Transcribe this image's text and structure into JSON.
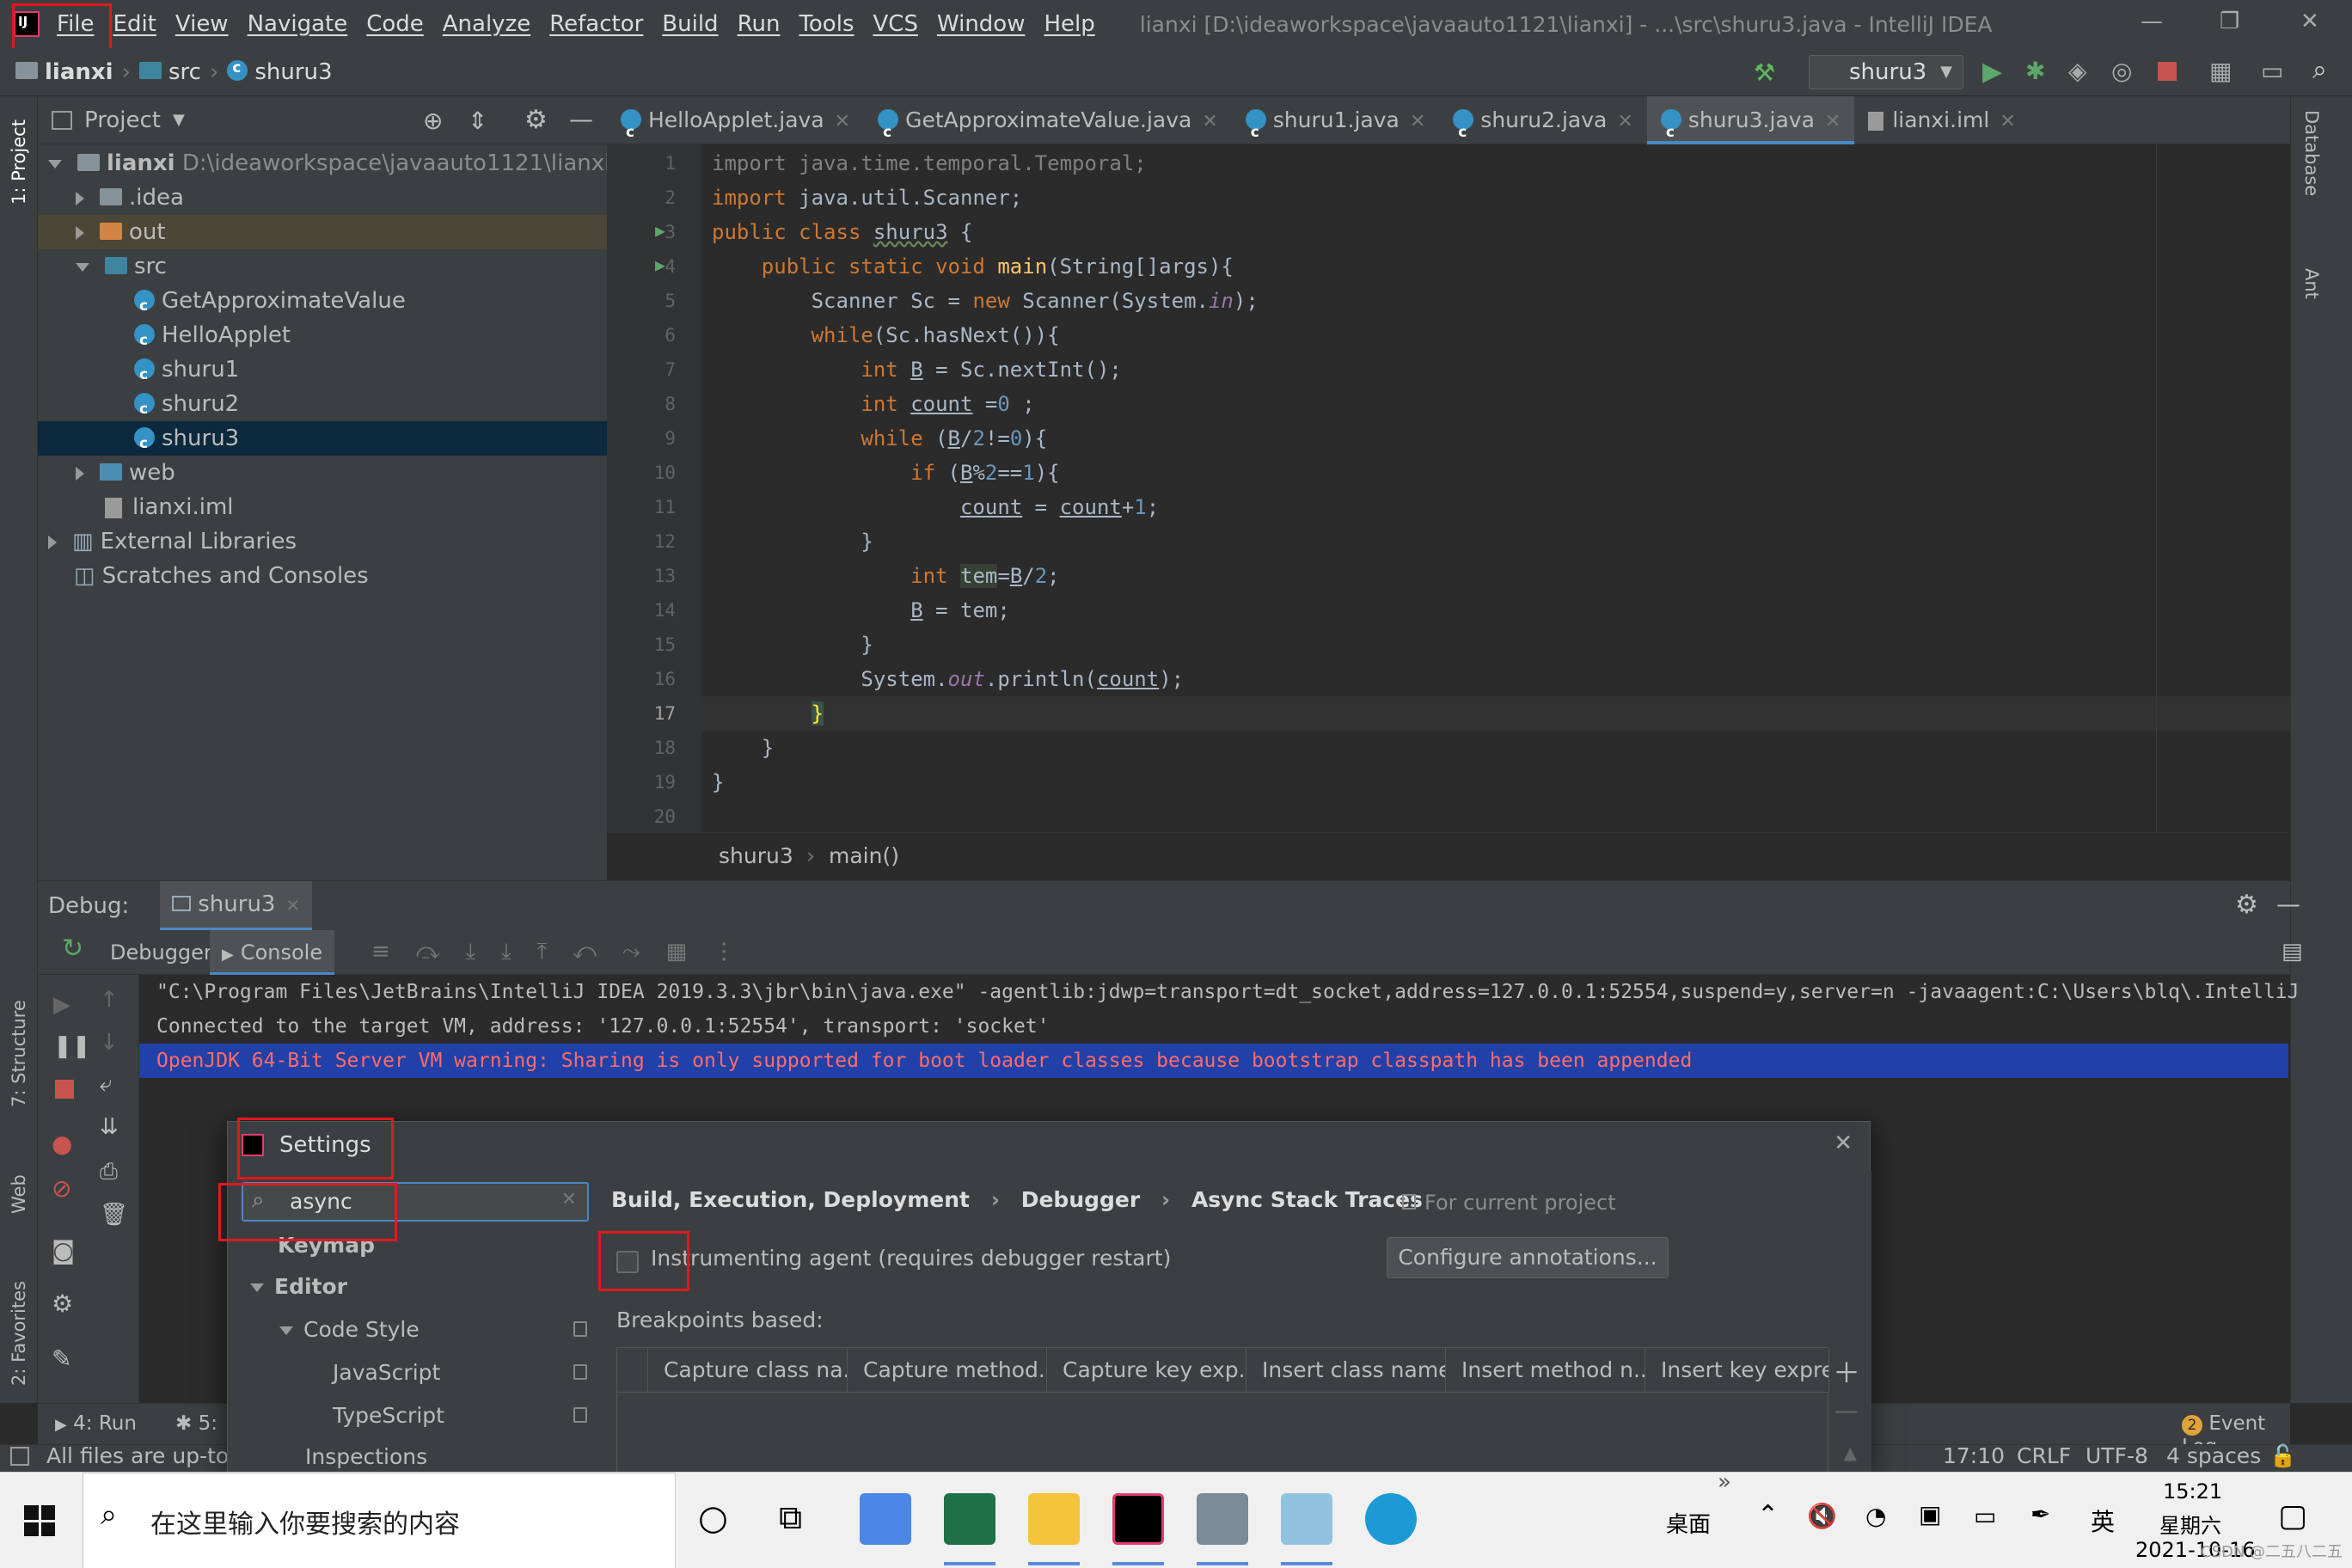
{
  "window": {
    "title": "lianxi [D:\\ideaworkspace\\javaauto1121\\lianxi] - ...\\src\\shuru3.java - IntelliJ IDEA",
    "menu": [
      "File",
      "Edit",
      "View",
      "Navigate",
      "Code",
      "Analyze",
      "Refactor",
      "Build",
      "Run",
      "Tools",
      "VCS",
      "Window",
      "Help"
    ]
  },
  "navbar": {
    "project": "lianxi",
    "folder": "src",
    "file": "shuru3",
    "run_config": "shuru3"
  },
  "project_panel": {
    "title": "Project",
    "root_name": "lianxi",
    "root_path": "D:\\ideaworkspace\\javaauto1121\\lianxi",
    "items": [
      ".idea",
      "out",
      "src",
      "GetApproximateValue",
      "HelloApplet",
      "shuru1",
      "shuru2",
      "shuru3",
      "web",
      "lianxi.iml",
      "External Libraries",
      "Scratches and Consoles"
    ]
  },
  "left_strip": {
    "project": "1: Project",
    "structure": "7: Structure",
    "web": "Web",
    "favorites": "2: Favorites"
  },
  "right_strip": {
    "database": "Database",
    "ant": "Ant"
  },
  "editor": {
    "tabs": [
      "HelloApplet.java",
      "GetApproximateValue.java",
      "shuru1.java",
      "shuru2.java",
      "shuru3.java",
      "lianxi.iml"
    ],
    "active_tab": 4,
    "line_numbers": [
      "1",
      "2",
      "3",
      "4",
      "5",
      "6",
      "7",
      "8",
      "9",
      "10",
      "11",
      "12",
      "13",
      "14",
      "15",
      "16",
      "17",
      "18",
      "19",
      "20"
    ],
    "breadcrumb": [
      "shuru3",
      "main()"
    ]
  },
  "debug": {
    "label": "Debug:",
    "session": "shuru3",
    "tabs": [
      "Debugger",
      "Console"
    ],
    "console_lines": [
      "\"C:\\Program Files\\JetBrains\\IntelliJ IDEA 2019.3.3\\jbr\\bin\\java.exe\" -agentlib:jdwp=transport=dt_socket,address=127.0.0.1:52554,suspend=y,server=n -javaagent:C:\\Users\\blq\\.IntelliJ",
      "Connected to the target VM, address: '127.0.0.1:52554', transport: 'socket'",
      "OpenJDK 64-Bit Server VM warning: Sharing is only supported for boot loader classes because bootstrap classpath has been appended"
    ]
  },
  "bottom_bar": {
    "run": "4: Run",
    "debug": "5:",
    "event_log": "Event Log",
    "event_count": "2"
  },
  "status": {
    "message": "All files are up-to-d",
    "position": "17:10",
    "line_sep": "CRLF",
    "encoding": "UTF-8",
    "indent": "4 spaces"
  },
  "settings": {
    "title": "Settings",
    "search_value": "async",
    "tree": [
      "Keymap",
      "Editor",
      "Code Style",
      "JavaScript",
      "TypeScript",
      "Inspections"
    ],
    "breadcrumb": [
      "Build, Execution, Deployment",
      "Debugger",
      "Async Stack Traces"
    ],
    "scope": "For current project",
    "checkbox_label": "Instrumenting agent (requires debugger restart)",
    "configure_button": "Configure annotations...",
    "section_label": "Breakpoints based:",
    "columns": [
      "Capture class na...",
      "Capture method...",
      "Capture key exp...",
      "Insert class name",
      "Insert method n...",
      "Insert key expre..."
    ]
  },
  "taskbar": {
    "search_placeholder": "在这里输入你要搜索的内容",
    "desktop": "桌面",
    "ime": "英",
    "time": "15:21",
    "weekday": "星期六",
    "date": "2021-10-16",
    "watermark": "CSDN @二五八二五"
  },
  "colors": {
    "accent": "#4a88c7",
    "annotation": "#e0191f",
    "selection": "#0d293e",
    "error_bg": "#2140a8",
    "error_text": "#ff6b68"
  }
}
